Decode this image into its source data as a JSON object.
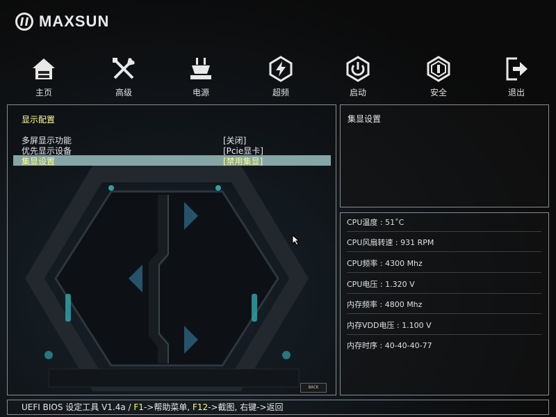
{
  "brand": {
    "name": "MAXSUN"
  },
  "nav": [
    {
      "label": "主页",
      "icon": "home-icon"
    },
    {
      "label": "高级",
      "icon": "tools-icon"
    },
    {
      "label": "电源",
      "icon": "power-plug-icon"
    },
    {
      "label": "超频",
      "icon": "overclock-icon"
    },
    {
      "label": "启动",
      "icon": "power-button-icon"
    },
    {
      "label": "安全",
      "icon": "shield-icon"
    },
    {
      "label": "退出",
      "icon": "exit-icon"
    }
  ],
  "main": {
    "section_title": "显示配置",
    "settings": [
      {
        "label": "多屏显示功能",
        "value": "[关闭]"
      },
      {
        "label": "优先显示设备",
        "value": "[Pcie显卡]"
      },
      {
        "label": "集显设置",
        "value": "[禁用集显]"
      }
    ],
    "back_label": "BACK"
  },
  "help": {
    "title": "集显设置"
  },
  "status": [
    {
      "label": "CPU温度",
      "value": "51˚C"
    },
    {
      "label": "CPU风扇转速",
      "value": "931 RPM"
    },
    {
      "label": "CPU频率",
      "value": "4300 Mhz"
    },
    {
      "label": "CPU电压",
      "value": "1.320 V"
    },
    {
      "label": "内存频率",
      "value": "4800 Mhz"
    },
    {
      "label": "内存VDD电压",
      "value": "1.100 V"
    },
    {
      "label": "内存时序",
      "value": "40-40-40-77"
    }
  ],
  "footer": {
    "prefix": "UEFI BIOS 设定工具 V1.4a / ",
    "f1_key": "F1",
    "f1_text": "->帮助菜单, ",
    "f12_key": "F12",
    "f12_text": "->截图, 右键->返回"
  },
  "colors": {
    "accent_yellow": "#ffff88",
    "selection": "#86a6a6",
    "teal_glow": "#3ecfd8"
  }
}
